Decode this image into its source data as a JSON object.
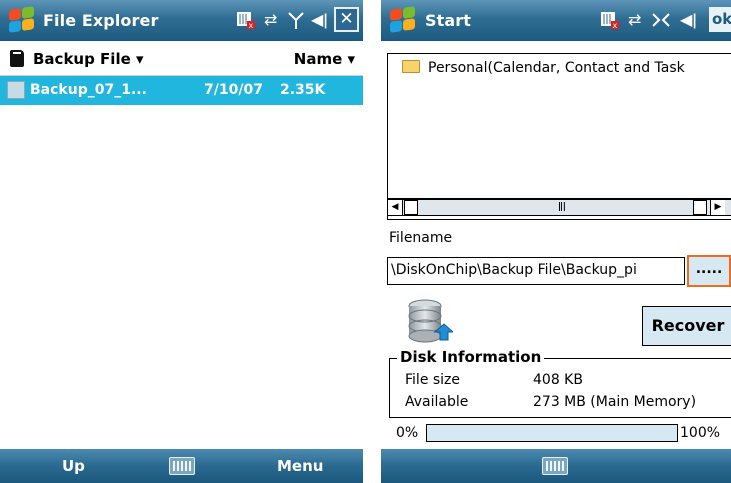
{
  "left_screen": {
    "title": "File Explorer",
    "folder_label": "Backup File ▾",
    "sort_label": "Name ▾",
    "files": [
      {
        "name": "Backup_07_1...",
        "date": "7/10/07",
        "size": "2.35K"
      }
    ],
    "softkeys": {
      "left": "Up",
      "right": "Menu"
    }
  },
  "right_screen": {
    "title": "Start",
    "ok_label": "ok",
    "list_items": [
      "Personal(Calendar, Contact and Task"
    ],
    "filename_label": "Filename",
    "filename_value": "\\DiskOnChip\\Backup File\\Backup_pi",
    "browse_label": ".....",
    "recover_label": "Recover",
    "disk_info_title": "Disk Information",
    "disk_info": [
      {
        "label": "File size",
        "value": "408 KB"
      },
      {
        "label": "Available",
        "value": "273 MB (Main Memory)"
      }
    ],
    "progress_min": "0%",
    "progress_max": "100%",
    "progress_value": 0
  },
  "colors": {
    "titlebar": "#2f6d93",
    "selection": "#20b6dd",
    "button_fill": "#d6e8f2",
    "focus_border": "#e86d1f"
  },
  "icons": [
    "windows-logo-icon",
    "barcode-icon",
    "sync-icon",
    "antenna-icon",
    "speaker-icon",
    "close-icon",
    "sd-card-icon",
    "file-icon",
    "folder-icon",
    "database-restore-icon",
    "keyboard-icon"
  ]
}
